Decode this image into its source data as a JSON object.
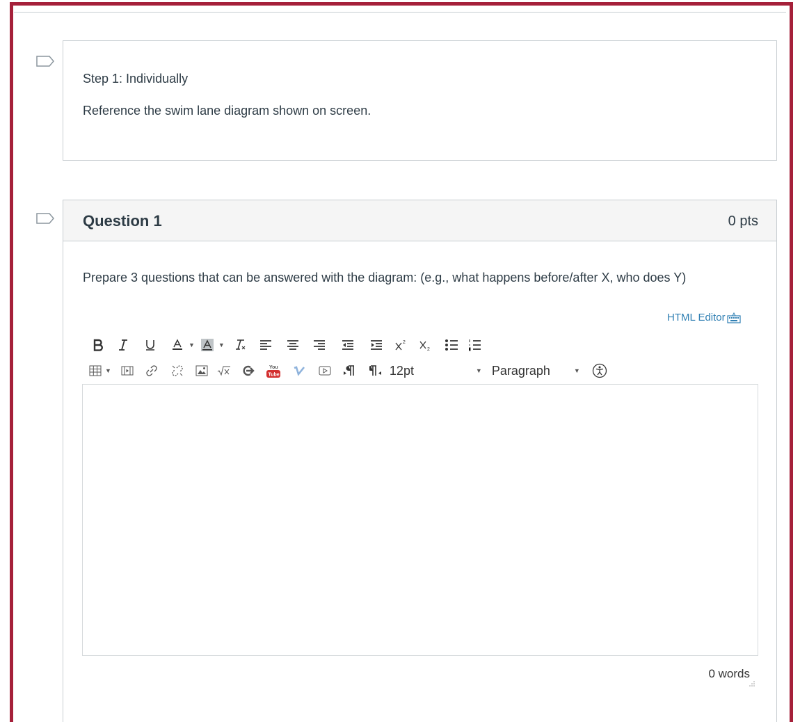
{
  "colors": {
    "frame": "#a5203a",
    "link": "#2f7fb3",
    "text": "#2d3b45",
    "header_bg": "#f5f5f5",
    "border": "#c7cdd1"
  },
  "step": {
    "heading": "Step 1: Individually",
    "instruction": "Reference the swim lane diagram shown on screen.",
    "flag_icon": "flag-outline-icon"
  },
  "question": {
    "title": "Question 1",
    "points": "0 pts",
    "flag_icon": "flag-outline-icon",
    "prompt": "Prepare 3 questions that can be answered with the diagram: (e.g., what happens before/after X, who does Y)"
  },
  "editor": {
    "html_editor_label": "HTML Editor",
    "font_size": "12pt",
    "block_format": "Paragraph",
    "word_count": "0 words",
    "content": "",
    "toolbar_row1": [
      "bold",
      "italic",
      "underline",
      "text-color",
      "background-color",
      "clear-formatting",
      "align-left",
      "align-center",
      "align-right",
      "outdent",
      "indent",
      "superscript",
      "subscript",
      "bullet-list",
      "numbered-list"
    ],
    "toolbar_row2": [
      "table",
      "media",
      "link",
      "unlink",
      "image",
      "equation",
      "lti-tool",
      "youtube",
      "vimeo",
      "embed",
      "ltr",
      "rtl",
      "font-size",
      "format",
      "accessibility-checker"
    ]
  }
}
